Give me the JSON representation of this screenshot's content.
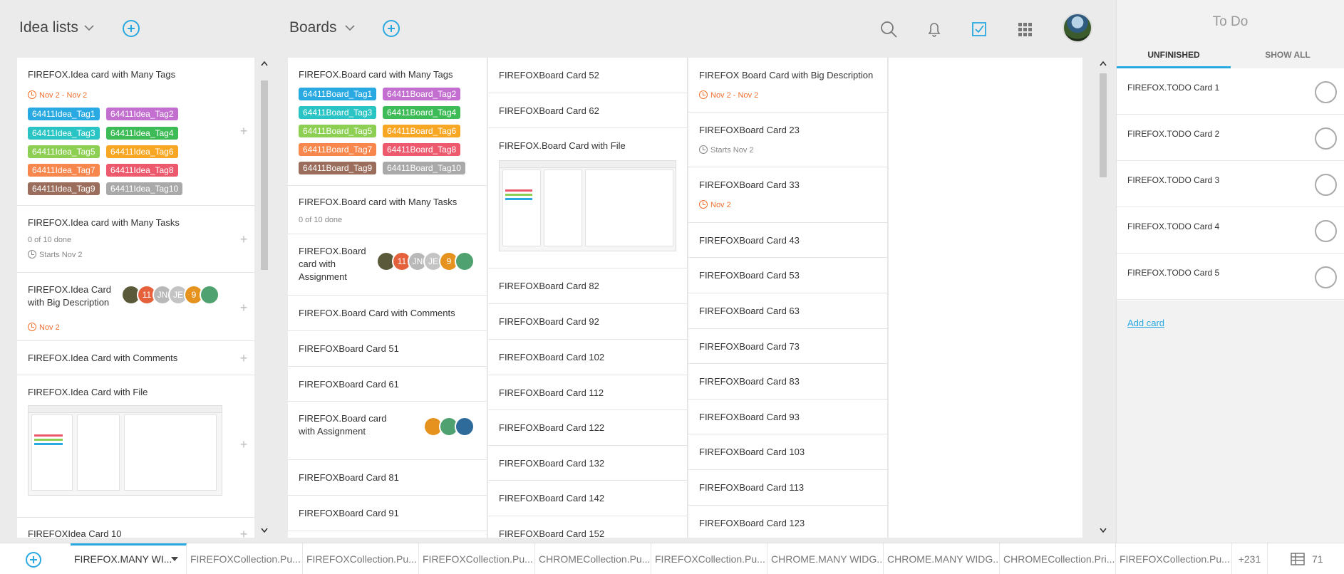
{
  "header": {
    "idea_lists_label": "Idea lists",
    "boards_label": "Boards"
  },
  "idea_column": {
    "cards": [
      {
        "title": "FIREFOX.Idea card with Many Tags",
        "date": "Nov 2 - Nov 2",
        "tags": [
          {
            "label": "64411Idea_Tag1",
            "color": "#29a9e1"
          },
          {
            "label": "64411Idea_Tag2",
            "color": "#c36fd0"
          },
          {
            "label": "64411Idea_Tag3",
            "color": "#2bc4c4"
          },
          {
            "label": "64411Idea_Tag4",
            "color": "#3dbb57"
          },
          {
            "label": "64411Idea_Tag5",
            "color": "#8ccf53"
          },
          {
            "label": "64411Idea_Tag6",
            "color": "#f8a725"
          },
          {
            "label": "64411Idea_Tag7",
            "color": "#f7874d"
          },
          {
            "label": "64411Idea_Tag8",
            "color": "#ee5a6d"
          },
          {
            "label": "64411Idea_Tag9",
            "color": "#9b6d5c"
          },
          {
            "label": "64411Idea_Tag10",
            "color": "#a9a9a9"
          }
        ]
      },
      {
        "title": "FIREFOX.Idea card with Many Tasks",
        "tasks": "0 of 10 done",
        "date": "Starts Nov 2"
      },
      {
        "title": "FIREFOX.Idea Card with Big Description",
        "date": "Nov 2",
        "avatar_letters": [
          "11",
          "JN",
          "JE",
          "9"
        ]
      },
      {
        "title": "FIREFOX.Idea Card with Comments"
      },
      {
        "title": "FIREFOX.Idea Card with File"
      },
      {
        "title": "FIREFOXIdea Card 10"
      }
    ]
  },
  "board_col1": {
    "cards": [
      {
        "title": "FIREFOX.Board card with Many Tags",
        "tags": [
          {
            "label": "64411Board_Tag1",
            "color": "#29a9e1"
          },
          {
            "label": "64411Board_Tag2",
            "color": "#c36fd0"
          },
          {
            "label": "64411Board_Tag3",
            "color": "#2bc4c4"
          },
          {
            "label": "64411Board_Tag4",
            "color": "#3dbb57"
          },
          {
            "label": "64411Board_Tag5",
            "color": "#8ccf53"
          },
          {
            "label": "64411Board_Tag6",
            "color": "#f8a725"
          },
          {
            "label": "64411Board_Tag7",
            "color": "#f7874d"
          },
          {
            "label": "64411Board_Tag8",
            "color": "#ee5a6d"
          },
          {
            "label": "64411Board_Tag9",
            "color": "#9b6d5c"
          },
          {
            "label": "64411Board_Tag10",
            "color": "#a9a9a9"
          }
        ]
      },
      {
        "title": "FIREFOX.Board card with Many Tasks",
        "tasks": "0 of 10 done"
      },
      {
        "title": "FIREFOX.Board card with Assignment",
        "avatar_letters": [
          "11",
          "JN",
          "JE",
          "9"
        ]
      },
      {
        "title": "FIREFOX.Board Card with Comments"
      },
      {
        "title": "FIREFOXBoard Card 51"
      },
      {
        "title": "FIREFOXBoard Card 61"
      },
      {
        "title": "FIREFOX.Board card with Assignment"
      },
      {
        "title": "FIREFOXBoard Card 81"
      },
      {
        "title": "FIREFOXBoard Card 91"
      }
    ]
  },
  "board_col2": {
    "cards": [
      {
        "title": "FIREFOXBoard Card 52"
      },
      {
        "title": "FIREFOXBoard Card 62"
      },
      {
        "title": "FIREFOX.Board Card with File"
      },
      {
        "title": "FIREFOXBoard Card 82"
      },
      {
        "title": "FIREFOXBoard Card 92"
      },
      {
        "title": "FIREFOXBoard Card 102"
      },
      {
        "title": "FIREFOXBoard Card 112"
      },
      {
        "title": "FIREFOXBoard Card 122"
      },
      {
        "title": "FIREFOXBoard Card 132"
      },
      {
        "title": "FIREFOXBoard Card 142"
      },
      {
        "title": "FIREFOXBoard Card 152"
      }
    ]
  },
  "board_col3": {
    "cards": [
      {
        "title": "FIREFOX Board Card with Big Description",
        "date": "Nov 2 - Nov 2"
      },
      {
        "title": "FIREFOXBoard Card 23",
        "date": "Starts Nov 2"
      },
      {
        "title": "FIREFOXBoard Card 33",
        "date": "Nov 2"
      },
      {
        "title": "FIREFOXBoard Card 43"
      },
      {
        "title": "FIREFOXBoard Card 53"
      },
      {
        "title": "FIREFOXBoard Card 63"
      },
      {
        "title": "FIREFOXBoard Card 73"
      },
      {
        "title": "FIREFOXBoard Card 83"
      },
      {
        "title": "FIREFOXBoard Card 93"
      },
      {
        "title": "FIREFOXBoard Card 103"
      },
      {
        "title": "FIREFOXBoard Card 113"
      },
      {
        "title": "FIREFOXBoard Card 123"
      }
    ]
  },
  "todo": {
    "title": "To Do",
    "tab_unfinished": "UNFINISHED",
    "tab_show_all": "SHOW ALL",
    "items": [
      "FIREFOX.TODO Card 1",
      "FIREFOX.TODO Card 2",
      "FIREFOX.TODO Card 3",
      "FIREFOX.TODO Card 4",
      "FIREFOX.TODO Card 5"
    ],
    "add_card": "Add card"
  },
  "bottom_tabs": {
    "tabs": [
      "FIREFOX.MANY WI...",
      "FIREFOXCollection.Pu...",
      "FIREFOXCollection.Pu...",
      "FIREFOXCollection.Pu...",
      "CHROMECollection.Pu...",
      "FIREFOXCollection.Pu...",
      "CHROME.MANY WIDG...",
      "CHROME.MANY WIDG...",
      "CHROMECollection.Pri...",
      "FIREFOXCollection.Pu..."
    ],
    "more_count": "+231",
    "widget_count": "71"
  },
  "colors": {
    "accent": "#29a9e1",
    "date_orange": "#f07030"
  }
}
